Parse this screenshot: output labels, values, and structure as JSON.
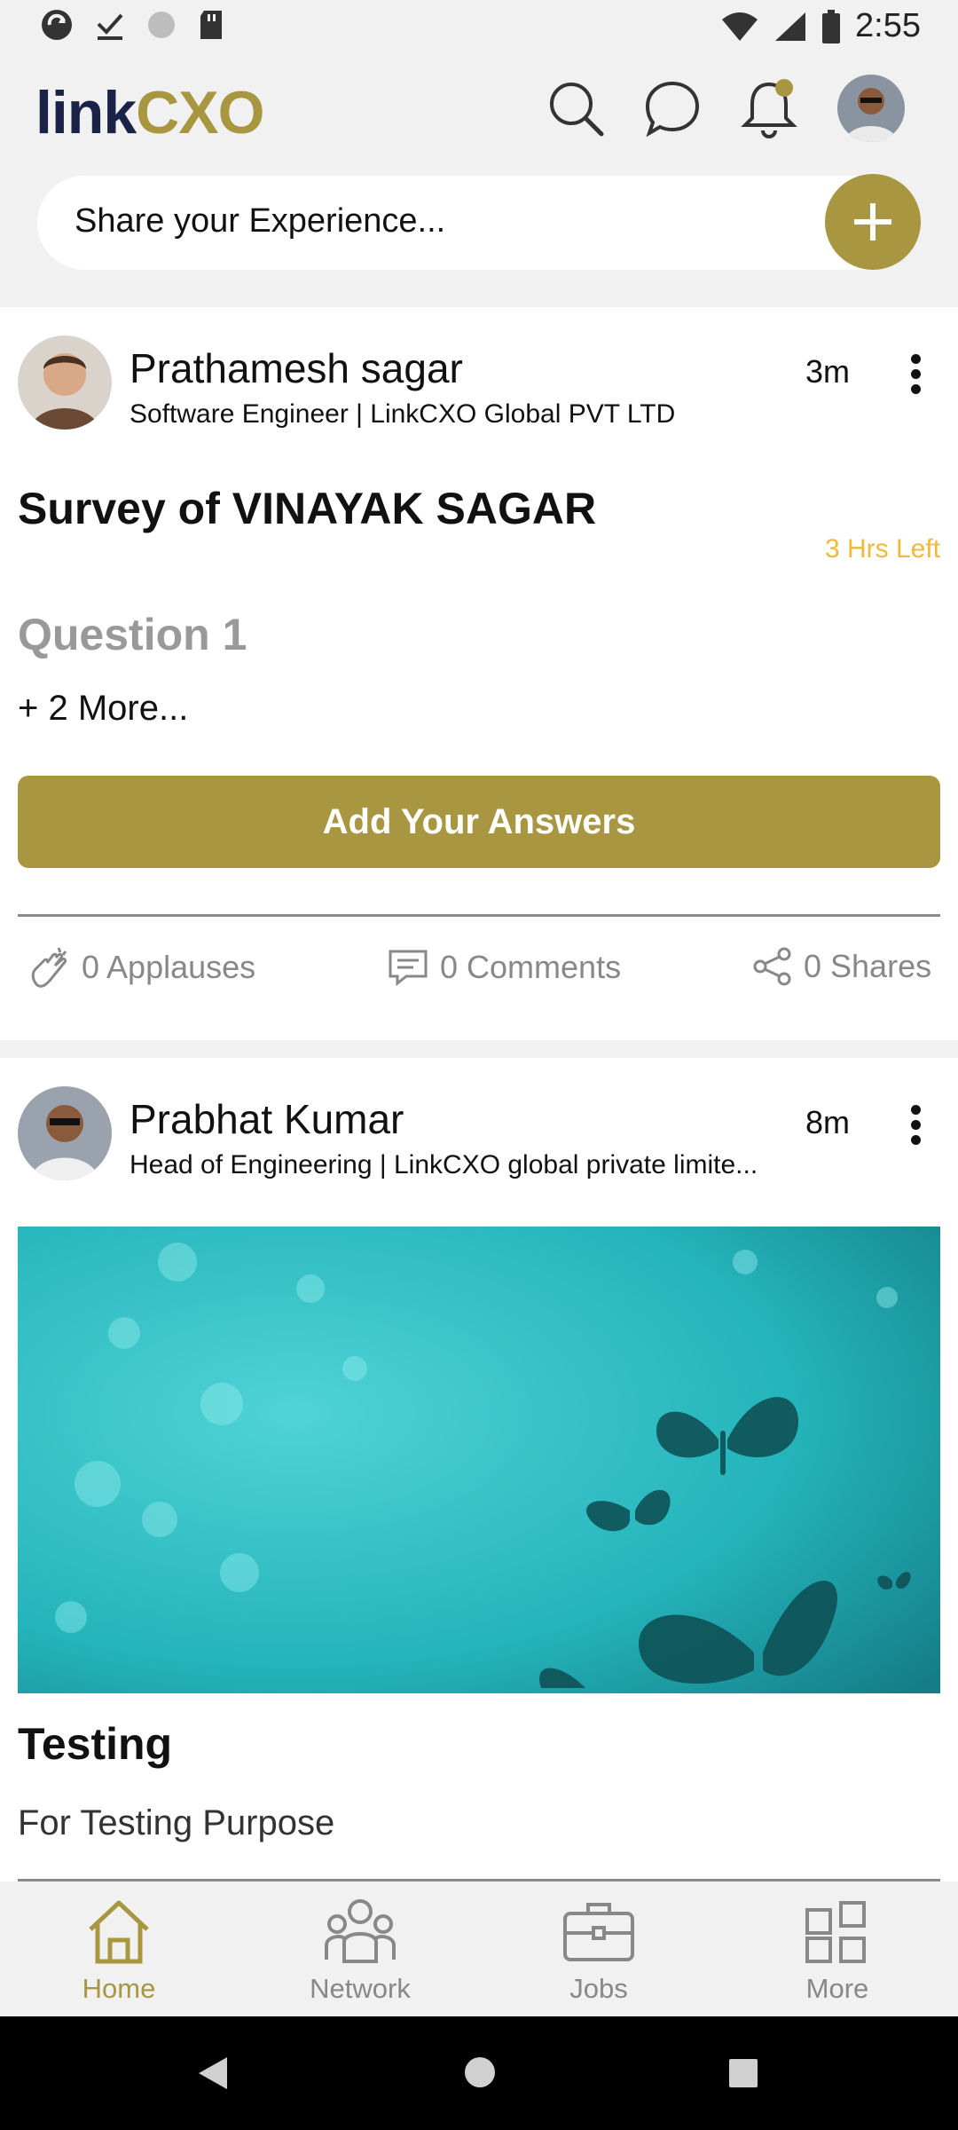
{
  "status_bar": {
    "time": "2:55",
    "left_icons": [
      "sync-icon",
      "download-done-icon",
      "circle-icon",
      "sd-card-icon"
    ],
    "right_icons": [
      "wifi-icon",
      "signal-icon",
      "battery-icon"
    ]
  },
  "header": {
    "logo_part1": "link",
    "logo_part2": "CXO",
    "icons": [
      "search-icon",
      "chat-icon",
      "bell-icon",
      "profile-avatar"
    ]
  },
  "share": {
    "placeholder": "Share your Experience..."
  },
  "posts": [
    {
      "author": "Prathamesh sagar",
      "subtitle": "Software  Engineer | LinkCXO Global PVT LTD",
      "time": "3m",
      "survey_title": "Survey of VINAYAK SAGAR",
      "hrs_left": "3 Hrs Left",
      "question": "Question 1",
      "more": "+ 2 More...",
      "answer_label": "Add Your Answers",
      "applauses": "0 Applauses",
      "comments": "0 Comments",
      "shares": "0 Shares"
    },
    {
      "author": "Prabhat Kumar",
      "subtitle": "Head of Engineering | LinkCXO global private limite...",
      "time": "8m",
      "title": "Testing",
      "description": "For Testing Purpose"
    }
  ],
  "bottom_nav": {
    "items": [
      {
        "label": "Home",
        "active": true
      },
      {
        "label": "Network",
        "active": false
      },
      {
        "label": "Jobs",
        "active": false
      },
      {
        "label": "More",
        "active": false
      }
    ]
  },
  "colors": {
    "accent": "#a99640",
    "navy": "#1b2247",
    "warning": "#f0b93c",
    "muted": "#888888",
    "background": "#f1f1f1"
  }
}
